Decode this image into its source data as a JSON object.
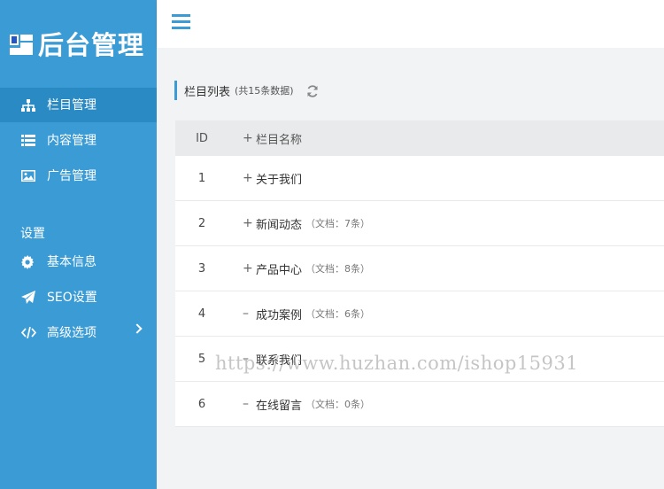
{
  "app": {
    "logo_text": "后台管理"
  },
  "sidebar": {
    "items": [
      {
        "label": "栏目管理",
        "icon": "sitemap-icon",
        "active": true
      },
      {
        "label": "内容管理",
        "icon": "list-icon"
      },
      {
        "label": "广告管理",
        "icon": "image-icon"
      }
    ],
    "section_title": "设置",
    "settings": [
      {
        "label": "基本信息",
        "icon": "gear-icon"
      },
      {
        "label": "SEO设置",
        "icon": "paper-plane-icon"
      },
      {
        "label": "高级选项",
        "icon": "code-icon",
        "has_arrow": true
      }
    ]
  },
  "main": {
    "title": "栏目列表",
    "count": "(共15条数据)",
    "table": {
      "headers": {
        "id": "ID",
        "name": "栏目名称",
        "name_prefix": "+"
      },
      "rows": [
        {
          "id": "1",
          "toggle": "+",
          "name": "关于我们",
          "docs": ""
        },
        {
          "id": "2",
          "toggle": "+",
          "name": "新闻动态",
          "docs": "（文档：7条）"
        },
        {
          "id": "3",
          "toggle": "+",
          "name": "产品中心",
          "docs": "（文档：8条）"
        },
        {
          "id": "4",
          "toggle": "–",
          "name": "成功案例",
          "docs": "（文档：6条）"
        },
        {
          "id": "5",
          "toggle": "–",
          "name": "联系我们",
          "docs": ""
        },
        {
          "id": "6",
          "toggle": "–",
          "name": "在线留言",
          "docs": "（文档：0条）"
        }
      ]
    }
  },
  "watermark": "https://www.huzhan.com/ishop15931",
  "colors": {
    "sidebar": "#3a9bd5",
    "sidebar_active": "#2a8ac4",
    "accent": "#3a9bd5"
  }
}
